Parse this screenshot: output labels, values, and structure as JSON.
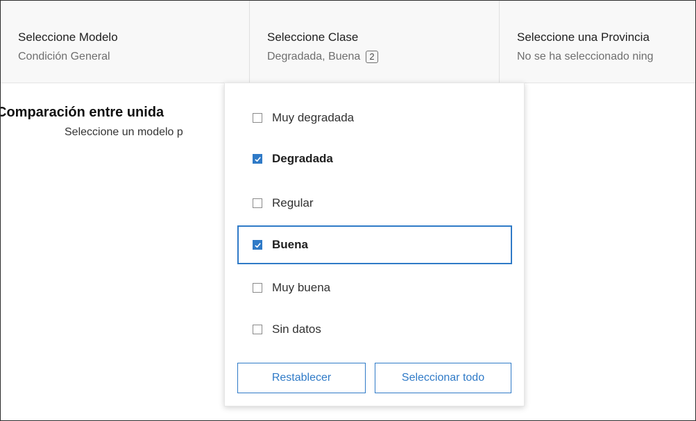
{
  "selectors": [
    {
      "title": "Seleccione Modelo",
      "value": "Condición General",
      "count": ""
    },
    {
      "title": "Seleccione Clase",
      "value": "Degradada, Buena",
      "count": "2"
    },
    {
      "title": "Seleccione una Provincia",
      "value": "No se ha seleccionado ning",
      "count": ""
    }
  ],
  "content": {
    "title": "Comparación entre unida",
    "subtitle": "Seleccione un modelo p"
  },
  "dropdown": {
    "options": [
      {
        "label": "Muy degradada",
        "checked": false
      },
      {
        "label": "Degradada",
        "checked": true
      },
      {
        "label": "Regular",
        "checked": false
      },
      {
        "label": "Buena",
        "checked": true
      },
      {
        "label": "Muy buena",
        "checked": false
      },
      {
        "label": "Sin datos",
        "checked": false
      }
    ],
    "reset_label": "Restablecer",
    "select_all_label": "Seleccionar todo"
  },
  "colors": {
    "accent": "#2f7ac7"
  }
}
